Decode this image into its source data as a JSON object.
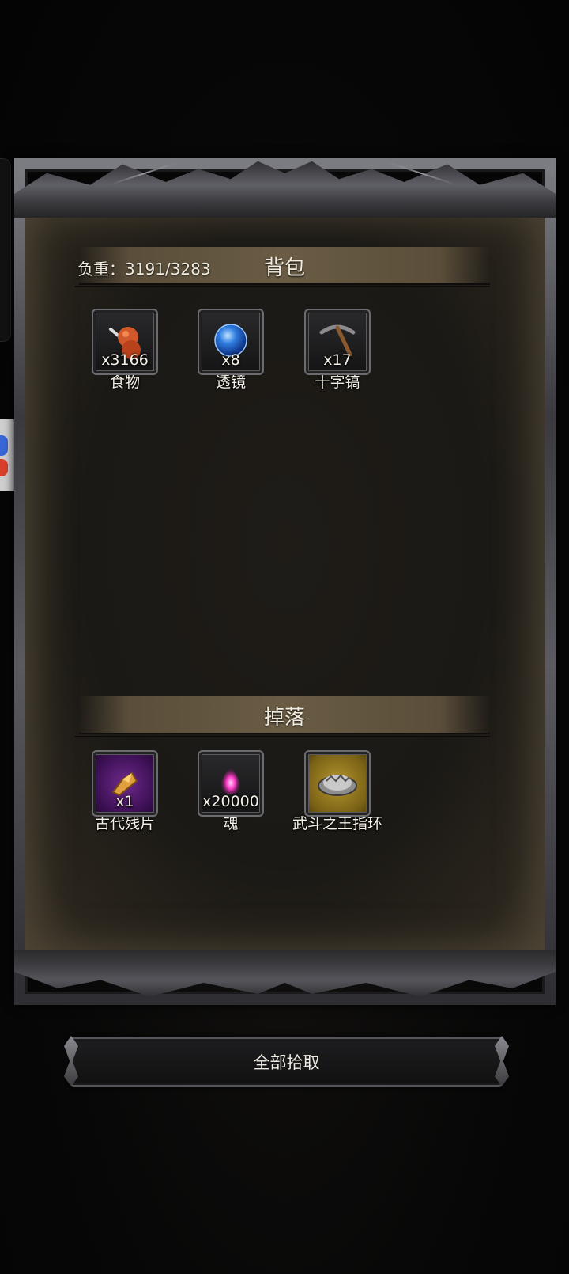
{
  "backpack": {
    "weight_label": "负重：3191/3283",
    "title": "背包",
    "items": [
      {
        "name": "食物",
        "count": "x3166",
        "icon": "food-drumstick-icon"
      },
      {
        "name": "透镜",
        "count": "x8",
        "icon": "blue-lens-orb-icon"
      },
      {
        "name": "十字镐",
        "count": "x17",
        "icon": "pickaxe-icon"
      }
    ]
  },
  "drops": {
    "title": "掉落",
    "items": [
      {
        "name": "古代残片",
        "count": "x1",
        "icon": "ancient-fragment-icon",
        "rarity_color": "#5a1f78"
      },
      {
        "name": "魂",
        "count": "x20000",
        "icon": "pink-soul-flame-icon"
      },
      {
        "name": "武斗之王指环",
        "count": "",
        "icon": "silver-ring-icon",
        "rarity_color": "#9a7d22"
      }
    ]
  },
  "actions": {
    "pickup_all_label": "全部拾取"
  },
  "colors": {
    "accent_band": "#6a5c44",
    "panel_bg": "#1b1915",
    "frame": "#4a4a4f"
  }
}
